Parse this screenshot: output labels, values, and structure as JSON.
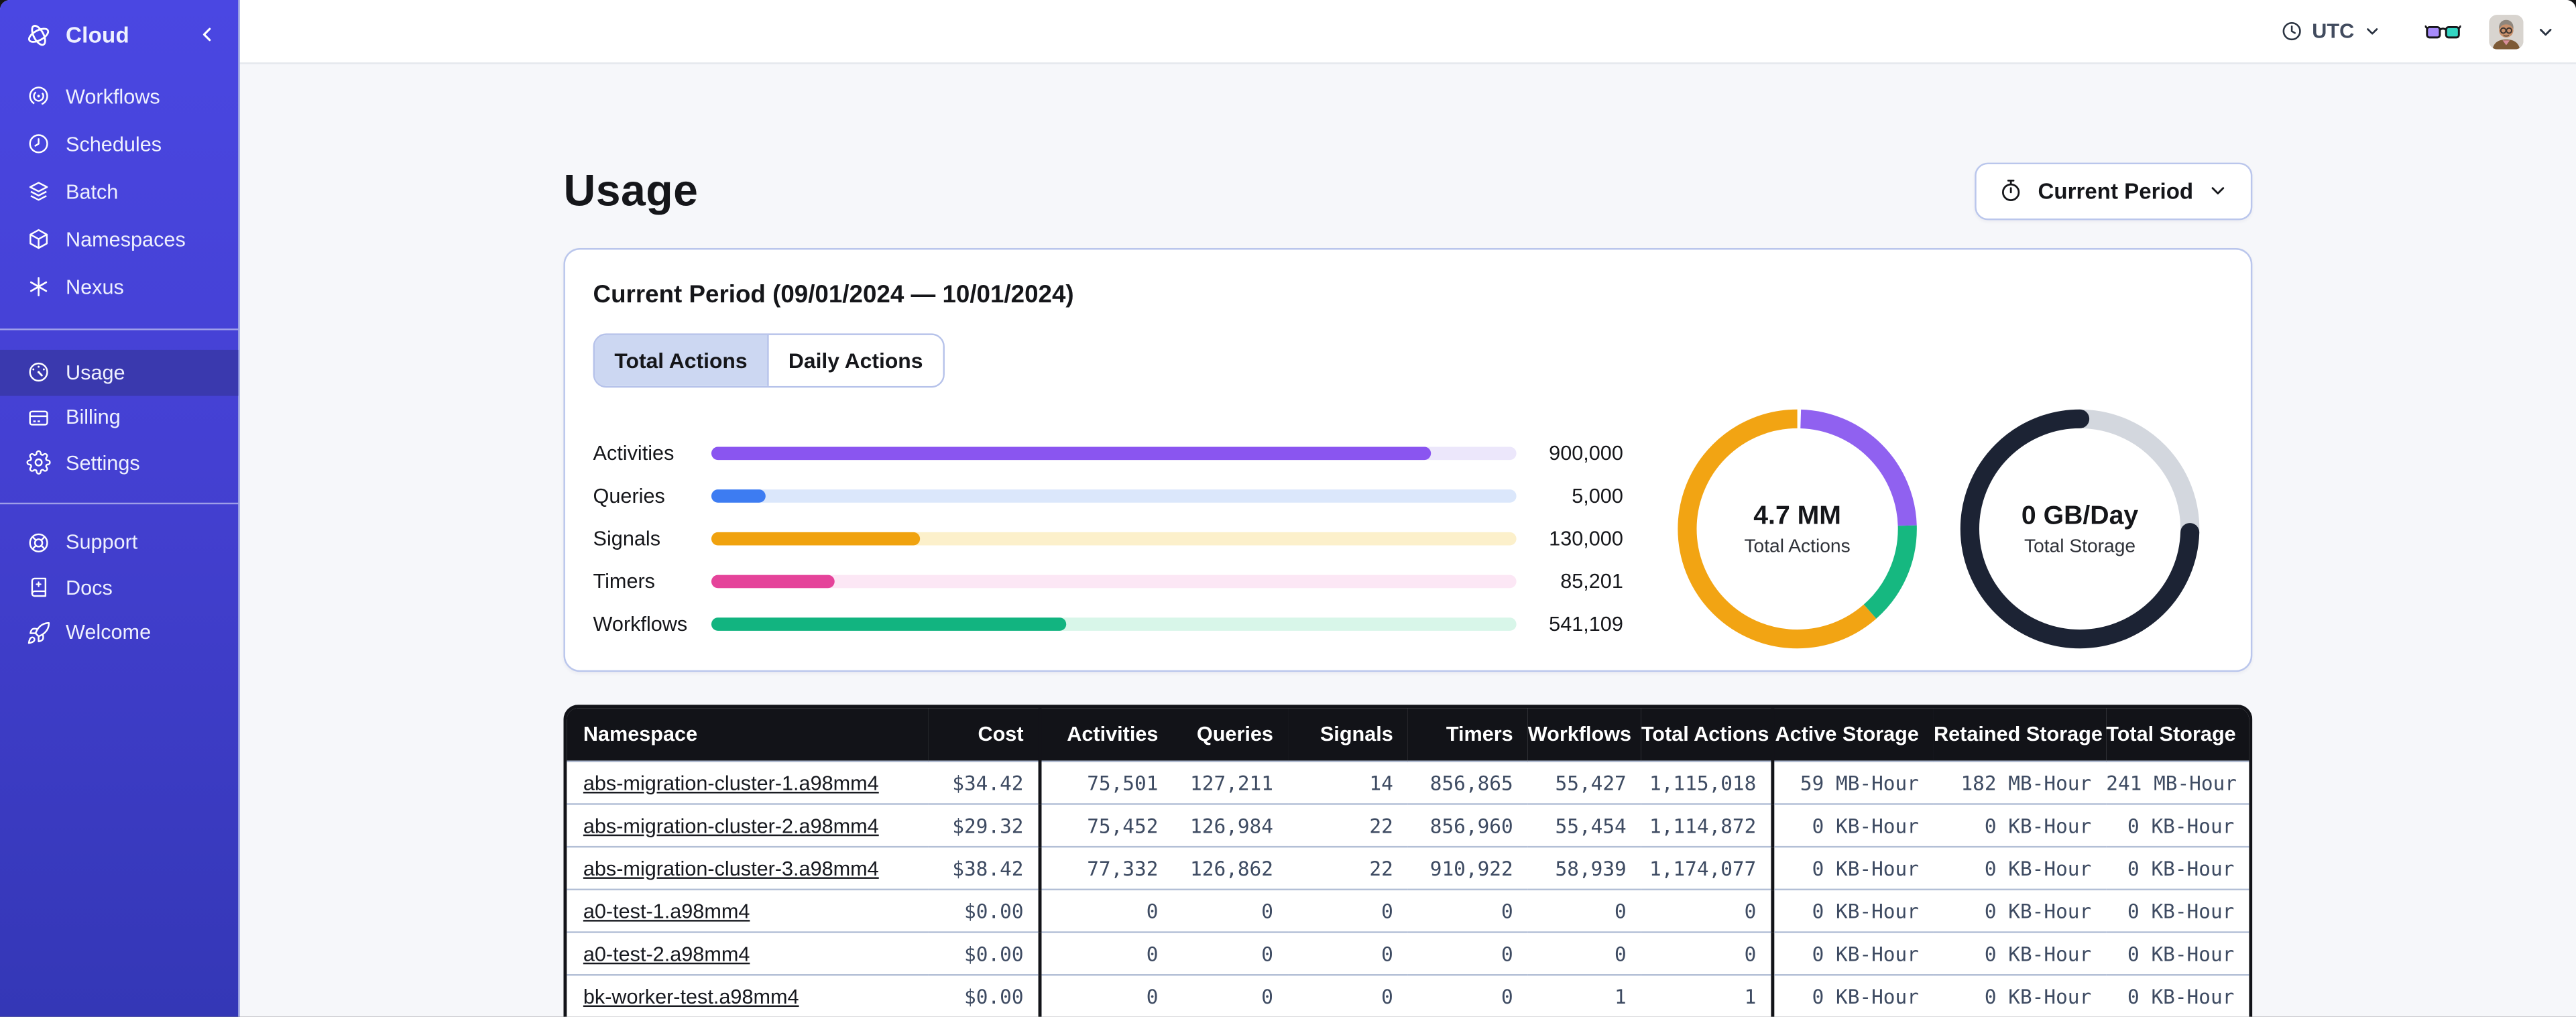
{
  "window": {
    "background": "#141416"
  },
  "sidebar": {
    "logo_label": "Cloud",
    "items_top": [
      {
        "label": "Workflows",
        "icon": "workflows-icon"
      },
      {
        "label": "Schedules",
        "icon": "schedules-icon"
      },
      {
        "label": "Batch",
        "icon": "batch-icon"
      },
      {
        "label": "Namespaces",
        "icon": "namespaces-icon"
      },
      {
        "label": "Nexus",
        "icon": "nexus-icon"
      }
    ],
    "items_account": [
      {
        "label": "Usage",
        "icon": "usage-gauge-icon",
        "active": true
      },
      {
        "label": "Billing",
        "icon": "billing-card-icon",
        "active": false
      },
      {
        "label": "Settings",
        "icon": "settings-gear-icon",
        "active": false
      }
    ],
    "items_help": [
      {
        "label": "Support",
        "icon": "support-lifebuoy-icon"
      },
      {
        "label": "Docs",
        "icon": "docs-book-icon"
      },
      {
        "label": "Welcome",
        "icon": "welcome-rocket-icon"
      }
    ],
    "colors": {
      "background_top": "#4a47e2",
      "background_bottom": "#3437b6",
      "active_item": "#3a39ae"
    }
  },
  "topbar": {
    "timezone": "UTC"
  },
  "page": {
    "title": "Usage",
    "period_selector_label": "Current Period"
  },
  "summary_card": {
    "title": "Current Period (09/01/2024 — 10/01/2024)",
    "tabs": [
      {
        "label": "Total Actions",
        "active": true
      },
      {
        "label": "Daily Actions",
        "active": false
      }
    ]
  },
  "chart_data": [
    {
      "type": "bar",
      "title": "Total Actions by type",
      "categories": [
        "Activities",
        "Queries",
        "Signals",
        "Timers",
        "Workflows"
      ],
      "values": [
        900000,
        5000,
        130000,
        85201,
        541109
      ],
      "value_labels": [
        "900,000",
        "5,000",
        "130,000",
        "85,201",
        "541,109"
      ],
      "fill_pct": [
        89.3,
        6.8,
        26,
        15.3,
        44
      ],
      "bar_colors": [
        "#8a55f0",
        "#3d7cf2",
        "#f0a20e",
        "#e5439a",
        "#12b480"
      ],
      "track_colors": [
        "#ece7fb",
        "#dbe7fb",
        "#fcf0cb",
        "#fce7f5",
        "#d8f6e9"
      ]
    },
    {
      "type": "donut",
      "center_value": "4.7 MM",
      "center_label": "Total Actions",
      "start_pct": 0.5,
      "segments": [
        {
          "name": "Activities",
          "color": "#9061f0",
          "pct": 24,
          "cap": "butt"
        },
        {
          "name": "Workflows",
          "color": "#16b880",
          "pct": 14,
          "cap": "butt"
        },
        {
          "name": "Signals",
          "color": "#f2a413",
          "pct": 62,
          "cap": "butt"
        }
      ]
    },
    {
      "type": "donut",
      "center_value": "0 GB/Day",
      "center_label": "Total Storage",
      "start_pct": 0.5,
      "segments": [
        {
          "name": "storage-remaining",
          "color": "#d3d7de",
          "pct": 25,
          "cap": "butt"
        },
        {
          "name": "storage-used",
          "color": "#1c2334",
          "pct": 75,
          "cap": "round"
        }
      ]
    }
  ],
  "table": {
    "columns": [
      "Namespace",
      "Cost",
      "Activities",
      "Queries",
      "Signals",
      "Timers",
      "Workflows",
      "Total Actions",
      "Active Storage",
      "Retained Storage",
      "Total Storage"
    ],
    "rows": [
      [
        "abs-migration-cluster-1.a98mm4",
        "$34.42",
        "75,501",
        "127,211",
        "14",
        "856,865",
        "55,427",
        "1,115,018",
        "59 MB-Hour",
        "182 MB-Hour",
        "241 MB-Hour"
      ],
      [
        "abs-migration-cluster-2.a98mm4",
        "$29.32",
        "75,452",
        "126,984",
        "22",
        "856,960",
        "55,454",
        "1,114,872",
        "0 KB-Hour",
        "0 KB-Hour",
        "0 KB-Hour"
      ],
      [
        "abs-migration-cluster-3.a98mm4",
        "$38.42",
        "77,332",
        "126,862",
        "22",
        "910,922",
        "58,939",
        "1,174,077",
        "0 KB-Hour",
        "0 KB-Hour",
        "0 KB-Hour"
      ],
      [
        "a0-test-1.a98mm4",
        "$0.00",
        "0",
        "0",
        "0",
        "0",
        "0",
        "0",
        "0 KB-Hour",
        "0 KB-Hour",
        "0 KB-Hour"
      ],
      [
        "a0-test-2.a98mm4",
        "$0.00",
        "0",
        "0",
        "0",
        "0",
        "0",
        "0",
        "0 KB-Hour",
        "0 KB-Hour",
        "0 KB-Hour"
      ],
      [
        "bk-worker-test.a98mm4",
        "$0.00",
        "0",
        "0",
        "0",
        "0",
        "1",
        "1",
        "0 KB-Hour",
        "0 KB-Hour",
        "0 KB-Hour"
      ]
    ]
  }
}
